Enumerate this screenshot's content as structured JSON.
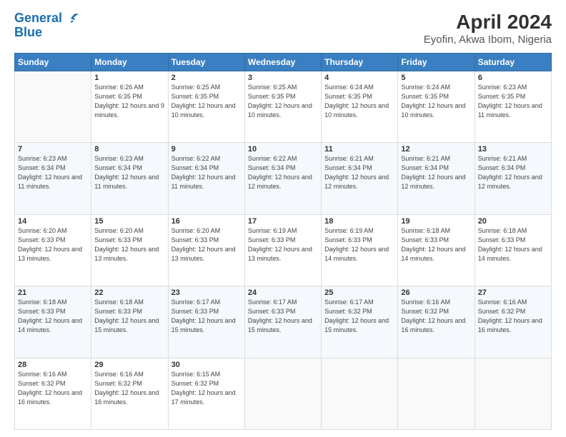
{
  "header": {
    "logo_line1": "General",
    "logo_line2": "Blue",
    "title": "April 2024",
    "subtitle": "Eyofin, Akwa Ibom, Nigeria"
  },
  "days_of_week": [
    "Sunday",
    "Monday",
    "Tuesday",
    "Wednesday",
    "Thursday",
    "Friday",
    "Saturday"
  ],
  "weeks": [
    [
      {
        "day": "",
        "sunrise": "",
        "sunset": "",
        "daylight": ""
      },
      {
        "day": "1",
        "sunrise": "Sunrise: 6:26 AM",
        "sunset": "Sunset: 6:35 PM",
        "daylight": "Daylight: 12 hours and 9 minutes."
      },
      {
        "day": "2",
        "sunrise": "Sunrise: 6:25 AM",
        "sunset": "Sunset: 6:35 PM",
        "daylight": "Daylight: 12 hours and 10 minutes."
      },
      {
        "day": "3",
        "sunrise": "Sunrise: 6:25 AM",
        "sunset": "Sunset: 6:35 PM",
        "daylight": "Daylight: 12 hours and 10 minutes."
      },
      {
        "day": "4",
        "sunrise": "Sunrise: 6:24 AM",
        "sunset": "Sunset: 6:35 PM",
        "daylight": "Daylight: 12 hours and 10 minutes."
      },
      {
        "day": "5",
        "sunrise": "Sunrise: 6:24 AM",
        "sunset": "Sunset: 6:35 PM",
        "daylight": "Daylight: 12 hours and 10 minutes."
      },
      {
        "day": "6",
        "sunrise": "Sunrise: 6:23 AM",
        "sunset": "Sunset: 6:35 PM",
        "daylight": "Daylight: 12 hours and 11 minutes."
      }
    ],
    [
      {
        "day": "7",
        "sunrise": "Sunrise: 6:23 AM",
        "sunset": "Sunset: 6:34 PM",
        "daylight": "Daylight: 12 hours and 11 minutes."
      },
      {
        "day": "8",
        "sunrise": "Sunrise: 6:23 AM",
        "sunset": "Sunset: 6:34 PM",
        "daylight": "Daylight: 12 hours and 11 minutes."
      },
      {
        "day": "9",
        "sunrise": "Sunrise: 6:22 AM",
        "sunset": "Sunset: 6:34 PM",
        "daylight": "Daylight: 12 hours and 11 minutes."
      },
      {
        "day": "10",
        "sunrise": "Sunrise: 6:22 AM",
        "sunset": "Sunset: 6:34 PM",
        "daylight": "Daylight: 12 hours and 12 minutes."
      },
      {
        "day": "11",
        "sunrise": "Sunrise: 6:21 AM",
        "sunset": "Sunset: 6:34 PM",
        "daylight": "Daylight: 12 hours and 12 minutes."
      },
      {
        "day": "12",
        "sunrise": "Sunrise: 6:21 AM",
        "sunset": "Sunset: 6:34 PM",
        "daylight": "Daylight: 12 hours and 12 minutes."
      },
      {
        "day": "13",
        "sunrise": "Sunrise: 6:21 AM",
        "sunset": "Sunset: 6:34 PM",
        "daylight": "Daylight: 12 hours and 12 minutes."
      }
    ],
    [
      {
        "day": "14",
        "sunrise": "Sunrise: 6:20 AM",
        "sunset": "Sunset: 6:33 PM",
        "daylight": "Daylight: 12 hours and 13 minutes."
      },
      {
        "day": "15",
        "sunrise": "Sunrise: 6:20 AM",
        "sunset": "Sunset: 6:33 PM",
        "daylight": "Daylight: 12 hours and 13 minutes."
      },
      {
        "day": "16",
        "sunrise": "Sunrise: 6:20 AM",
        "sunset": "Sunset: 6:33 PM",
        "daylight": "Daylight: 12 hours and 13 minutes."
      },
      {
        "day": "17",
        "sunrise": "Sunrise: 6:19 AM",
        "sunset": "Sunset: 6:33 PM",
        "daylight": "Daylight: 12 hours and 13 minutes."
      },
      {
        "day": "18",
        "sunrise": "Sunrise: 6:19 AM",
        "sunset": "Sunset: 6:33 PM",
        "daylight": "Daylight: 12 hours and 14 minutes."
      },
      {
        "day": "19",
        "sunrise": "Sunrise: 6:18 AM",
        "sunset": "Sunset: 6:33 PM",
        "daylight": "Daylight: 12 hours and 14 minutes."
      },
      {
        "day": "20",
        "sunrise": "Sunrise: 6:18 AM",
        "sunset": "Sunset: 6:33 PM",
        "daylight": "Daylight: 12 hours and 14 minutes."
      }
    ],
    [
      {
        "day": "21",
        "sunrise": "Sunrise: 6:18 AM",
        "sunset": "Sunset: 6:33 PM",
        "daylight": "Daylight: 12 hours and 14 minutes."
      },
      {
        "day": "22",
        "sunrise": "Sunrise: 6:18 AM",
        "sunset": "Sunset: 6:33 PM",
        "daylight": "Daylight: 12 hours and 15 minutes."
      },
      {
        "day": "23",
        "sunrise": "Sunrise: 6:17 AM",
        "sunset": "Sunset: 6:33 PM",
        "daylight": "Daylight: 12 hours and 15 minutes."
      },
      {
        "day": "24",
        "sunrise": "Sunrise: 6:17 AM",
        "sunset": "Sunset: 6:33 PM",
        "daylight": "Daylight: 12 hours and 15 minutes."
      },
      {
        "day": "25",
        "sunrise": "Sunrise: 6:17 AM",
        "sunset": "Sunset: 6:32 PM",
        "daylight": "Daylight: 12 hours and 15 minutes."
      },
      {
        "day": "26",
        "sunrise": "Sunrise: 6:16 AM",
        "sunset": "Sunset: 6:32 PM",
        "daylight": "Daylight: 12 hours and 16 minutes."
      },
      {
        "day": "27",
        "sunrise": "Sunrise: 6:16 AM",
        "sunset": "Sunset: 6:32 PM",
        "daylight": "Daylight: 12 hours and 16 minutes."
      }
    ],
    [
      {
        "day": "28",
        "sunrise": "Sunrise: 6:16 AM",
        "sunset": "Sunset: 6:32 PM",
        "daylight": "Daylight: 12 hours and 16 minutes."
      },
      {
        "day": "29",
        "sunrise": "Sunrise: 6:16 AM",
        "sunset": "Sunset: 6:32 PM",
        "daylight": "Daylight: 12 hours and 16 minutes."
      },
      {
        "day": "30",
        "sunrise": "Sunrise: 6:15 AM",
        "sunset": "Sunset: 6:32 PM",
        "daylight": "Daylight: 12 hours and 17 minutes."
      },
      {
        "day": "",
        "sunrise": "",
        "sunset": "",
        "daylight": ""
      },
      {
        "day": "",
        "sunrise": "",
        "sunset": "",
        "daylight": ""
      },
      {
        "day": "",
        "sunrise": "",
        "sunset": "",
        "daylight": ""
      },
      {
        "day": "",
        "sunrise": "",
        "sunset": "",
        "daylight": ""
      }
    ]
  ]
}
